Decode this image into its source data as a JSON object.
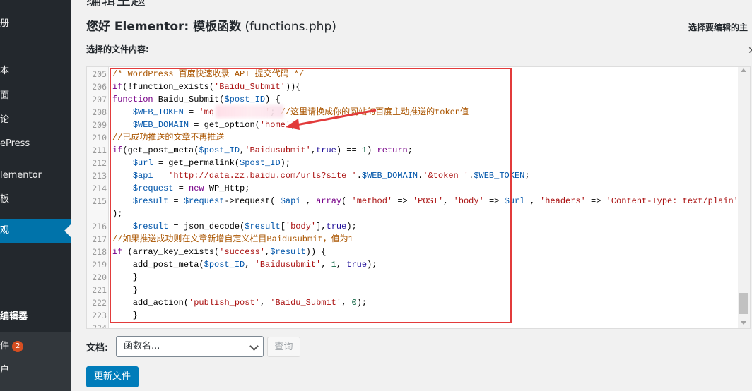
{
  "sidebar": {
    "items": [
      {
        "label": "册"
      },
      {
        "label": "本"
      },
      {
        "label": "面"
      },
      {
        "label": "论"
      },
      {
        "label": "ePress"
      },
      {
        "label": "lementor"
      },
      {
        "label": "板"
      },
      {
        "label": "观"
      },
      {
        "label": "编辑器"
      },
      {
        "label": "件",
        "badge": "2"
      },
      {
        "label": "户"
      }
    ]
  },
  "page": {
    "heading": "编辑主题",
    "file_title_prefix": "您好 Elementor: 模板函数",
    "file_title_file": "(functions.php)",
    "select_theme_label": "选择要编辑的主",
    "close_glyph": "✕",
    "content_label": "选择的文件内容:"
  },
  "editor": {
    "lines": [
      {
        "n": "205",
        "parts": [
          [
            "cm",
            "/* WordPress 百度快速收录 API 提交代码 */"
          ]
        ]
      },
      {
        "n": "206",
        "parts": [
          [
            "kw",
            "if"
          ],
          [
            "",
            "(!function_exists("
          ],
          [
            "str",
            "'Baidu_Submit'"
          ],
          [
            "",
            ")){"
          ]
        ]
      },
      {
        "n": "207",
        "parts": [
          [
            "kw",
            "function"
          ],
          [
            "",
            " Baidu_Submit("
          ],
          [
            "var",
            "$post_ID"
          ],
          [
            "",
            ") {"
          ]
        ]
      },
      {
        "n": "208",
        "parts": [
          [
            "",
            "    "
          ],
          [
            "var",
            "$WEB_TOKEN"
          ],
          [
            "",
            " = "
          ],
          [
            "str",
            "'mq          '"
          ],
          [
            "",
            "; "
          ],
          [
            "cm",
            "//这里请换成你的网站的百度主动推送的token值"
          ]
        ]
      },
      {
        "n": "209",
        "parts": [
          [
            "",
            "    "
          ],
          [
            "var",
            "$WEB_DOMAIN"
          ],
          [
            "",
            " = get_option("
          ],
          [
            "str",
            "'home'"
          ],
          [
            "",
            ");"
          ]
        ]
      },
      {
        "n": "210",
        "parts": [
          [
            "cm",
            "//已成功推送的文章不再推送"
          ]
        ]
      },
      {
        "n": "211",
        "parts": [
          [
            "kw",
            "if"
          ],
          [
            "",
            "(get_post_meta("
          ],
          [
            "var",
            "$post_ID"
          ],
          [
            "",
            ","
          ],
          [
            "str",
            "'Baidusubmit'"
          ],
          [
            "",
            ","
          ],
          [
            "atom",
            "true"
          ],
          [
            "",
            ") == "
          ],
          [
            "num",
            "1"
          ],
          [
            "",
            ") "
          ],
          [
            "kw",
            "return"
          ],
          [
            "",
            ";"
          ]
        ]
      },
      {
        "n": "212",
        "parts": [
          [
            "",
            "    "
          ],
          [
            "var",
            "$url"
          ],
          [
            "",
            " = get_permalink("
          ],
          [
            "var",
            "$post_ID"
          ],
          [
            "",
            ");"
          ]
        ]
      },
      {
        "n": "213",
        "parts": [
          [
            "",
            "    "
          ],
          [
            "var",
            "$api"
          ],
          [
            "",
            " = "
          ],
          [
            "str",
            "'http://data.zz.baidu.com/urls?site='"
          ],
          [
            "",
            "."
          ],
          [
            "var",
            "$WEB_DOMAIN"
          ],
          [
            "",
            "."
          ],
          [
            "str",
            "'&token='"
          ],
          [
            "",
            "."
          ],
          [
            "var",
            "$WEB_TOKEN"
          ],
          [
            "",
            ";"
          ]
        ]
      },
      {
        "n": "214",
        "parts": [
          [
            "",
            "    "
          ],
          [
            "var",
            "$request"
          ],
          [
            "",
            " = "
          ],
          [
            "kw",
            "new"
          ],
          [
            "",
            " WP_Http;"
          ]
        ]
      },
      {
        "n": "215",
        "parts": [
          [
            "",
            "    "
          ],
          [
            "var",
            "$result"
          ],
          [
            "",
            " = "
          ],
          [
            "var",
            "$request"
          ],
          [
            "",
            "->request( "
          ],
          [
            "var",
            "$api"
          ],
          [
            "",
            " , "
          ],
          [
            "kw",
            "array"
          ],
          [
            "",
            "( "
          ],
          [
            "str",
            "'method'"
          ],
          [
            "",
            " => "
          ],
          [
            "str",
            "'POST'"
          ],
          [
            "",
            ", "
          ],
          [
            "str",
            "'body'"
          ],
          [
            "",
            " => "
          ],
          [
            "var",
            "$url"
          ],
          [
            "",
            " , "
          ],
          [
            "str",
            "'headers'"
          ],
          [
            "",
            " => "
          ],
          [
            "str",
            "'Content-Type: text/plain'"
          ],
          [
            "",
            ")"
          ]
        ]
      },
      {
        "n": "",
        "parts": [
          [
            "",
            ");"
          ]
        ]
      },
      {
        "n": "216",
        "parts": [
          [
            "",
            "    "
          ],
          [
            "var",
            "$result"
          ],
          [
            "",
            " = json_decode("
          ],
          [
            "var",
            "$result"
          ],
          [
            "",
            "["
          ],
          [
            "str",
            "'body'"
          ],
          [
            "",
            "],"
          ],
          [
            "atom",
            "true"
          ],
          [
            "",
            ");"
          ]
        ]
      },
      {
        "n": "217",
        "parts": [
          [
            "cm",
            "//如果推送成功则在文章新增自定义栏目Baidusubmit，值为1"
          ]
        ]
      },
      {
        "n": "218",
        "parts": [
          [
            "kw",
            "if"
          ],
          [
            "",
            " (array_key_exists("
          ],
          [
            "str",
            "'success'"
          ],
          [
            "",
            ","
          ],
          [
            "var",
            "$result"
          ],
          [
            "",
            ")) {"
          ]
        ]
      },
      {
        "n": "219",
        "parts": [
          [
            "",
            "    add_post_meta("
          ],
          [
            "var",
            "$post_ID"
          ],
          [
            "",
            ", "
          ],
          [
            "str",
            "'Baidusubmit'"
          ],
          [
            "",
            ", "
          ],
          [
            "num",
            "1"
          ],
          [
            "",
            ", "
          ],
          [
            "atom",
            "true"
          ],
          [
            "",
            ");"
          ]
        ]
      },
      {
        "n": "220",
        "parts": [
          [
            "",
            "    }"
          ]
        ]
      },
      {
        "n": "221",
        "parts": [
          [
            "",
            "    }"
          ]
        ]
      },
      {
        "n": "222",
        "parts": [
          [
            "",
            "    add_action("
          ],
          [
            "str",
            "'publish_post'"
          ],
          [
            "",
            ", "
          ],
          [
            "str",
            "'Baidu_Submit'"
          ],
          [
            "",
            ", "
          ],
          [
            "num",
            "0"
          ],
          [
            "",
            ");"
          ]
        ]
      },
      {
        "n": "223",
        "parts": [
          [
            "",
            "    }"
          ]
        ]
      },
      {
        "n": "224",
        "parts": [
          [
            "",
            ""
          ]
        ]
      }
    ]
  },
  "footer": {
    "doc_label": "文档:",
    "doc_select_placeholder": "函数名...",
    "lookup_button": "查询",
    "update_button": "更新文件"
  },
  "colors": {
    "sidebar_bg": "#23282d",
    "active_menu": "#0073aa",
    "highlight_box": "#e23b3b",
    "primary_button": "#007cba"
  }
}
